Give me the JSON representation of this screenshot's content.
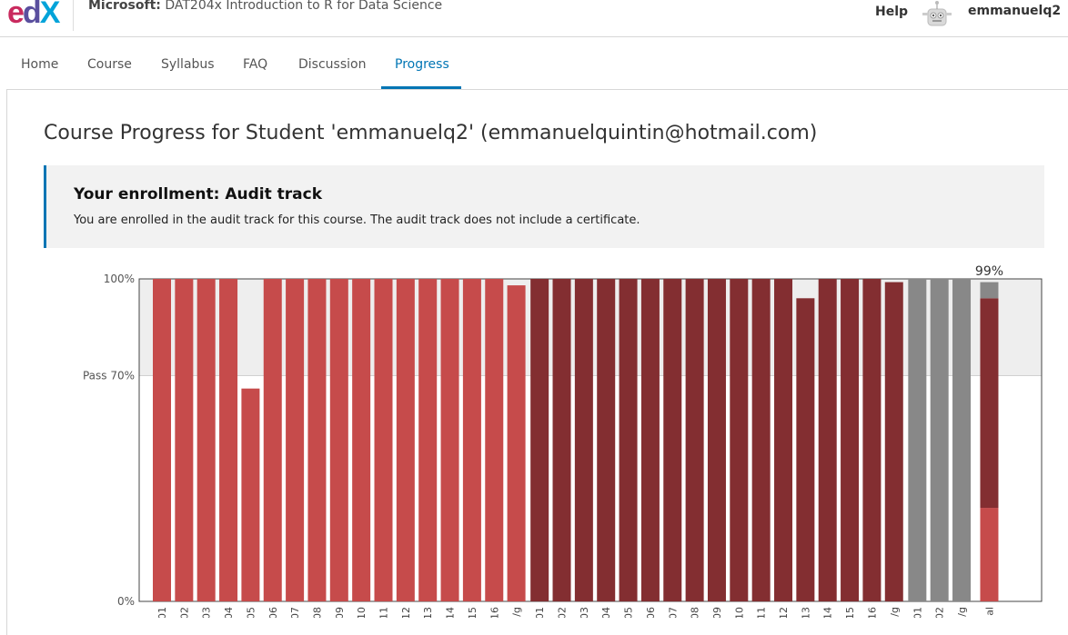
{
  "header": {
    "org": "Microsoft:",
    "course": "DAT204x Introduction to R for Data Science",
    "help_label": "Help",
    "username": "emmanuelq2",
    "logo": {
      "e": "e",
      "d": "d",
      "x": "X"
    }
  },
  "nav": {
    "tabs": [
      "Home",
      "Course",
      "Syllabus",
      "FAQ",
      "Discussion",
      "Progress"
    ],
    "active": "Progress"
  },
  "page_title": "Course Progress for Student 'emmanuelq2' (emmanuelquintin@hotmail.com)",
  "notice": {
    "title": "Your enrollment: Audit track",
    "text": "You are enrolled in the audit track for this course. The audit track does not include a certificate."
  },
  "colors": {
    "accent": "#0075b4",
    "lab": "#c64b4b",
    "quiz": "#832e31",
    "ungraded": "#888888",
    "pass_band": "#eeeeee"
  },
  "chart_data": {
    "type": "bar",
    "ylim": [
      0,
      100
    ],
    "y_ticks": [
      {
        "value": 100,
        "label": "100%"
      },
      {
        "value": 70,
        "label": "Pass 70%"
      },
      {
        "value": 0,
        "label": "0%"
      }
    ],
    "overall_label": "99%",
    "series": [
      {
        "kind": "lab",
        "categories": [
          "01",
          "02",
          "03",
          "04",
          "05",
          "06",
          "07",
          "08",
          "09",
          "10",
          "11",
          "12",
          "13",
          "14",
          "15",
          "16",
          "/g"
        ],
        "values": [
          100,
          100,
          100,
          100,
          66,
          100,
          100,
          100,
          100,
          100,
          100,
          100,
          100,
          100,
          100,
          100,
          98
        ]
      },
      {
        "kind": "quiz",
        "categories": [
          "01",
          "02",
          "03",
          "04",
          "05",
          "06",
          "07",
          "08",
          "09",
          "10",
          "11",
          "12",
          "13",
          "14",
          "15",
          "16",
          "/g"
        ],
        "values": [
          100,
          100,
          100,
          100,
          100,
          100,
          100,
          100,
          100,
          100,
          100,
          100,
          94,
          100,
          100,
          100,
          99
        ]
      },
      {
        "kind": "ungraded",
        "categories": [
          "01",
          "02",
          "/g"
        ],
        "values": [
          100,
          100,
          100
        ]
      }
    ],
    "total": {
      "category": "al",
      "stack": [
        {
          "kind": "lab",
          "value": 29
        },
        {
          "kind": "quiz",
          "value": 65
        },
        {
          "kind": "ungraded",
          "value": 5
        }
      ]
    }
  }
}
